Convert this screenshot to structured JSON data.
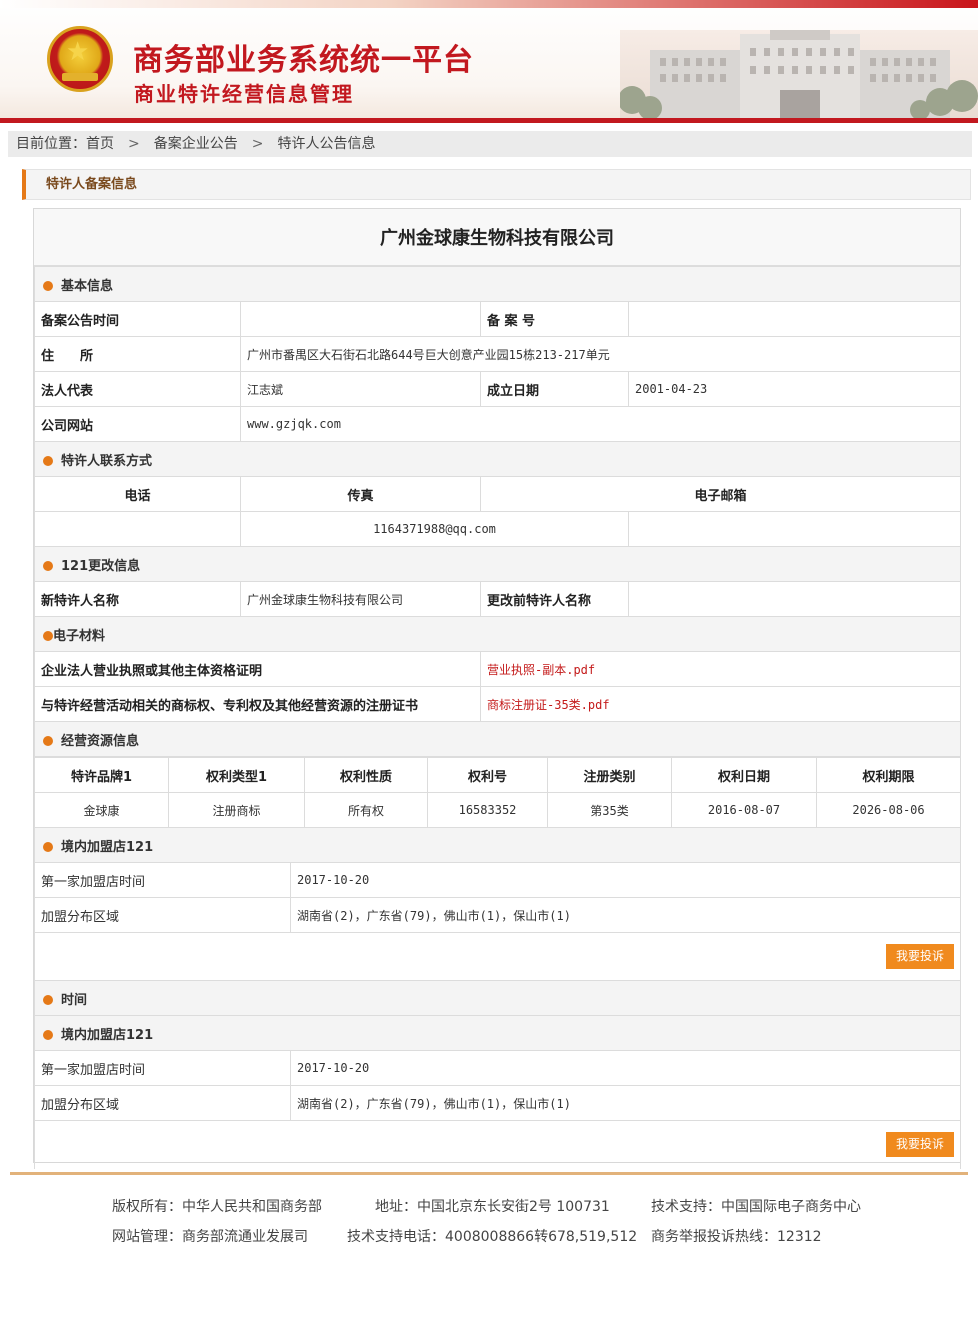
{
  "header": {
    "title": "商务部业务系统统一平台",
    "subtitle": "商业特许经营信息管理",
    "brand_color": "#c2181f"
  },
  "breadcrumb": {
    "prefix": "目前位置：",
    "items": [
      "首页",
      "备案企业公告",
      "特许人公告信息"
    ],
    "separator": ">"
  },
  "section_title": "特许人备案信息",
  "company_name": "广州金球康生物科技有限公司",
  "basic": {
    "heading": "基本信息",
    "record_time_label": "备案公告时间",
    "record_time_value": "",
    "record_no_label": "备 案 号",
    "record_no_value": "",
    "address_label": "住　　所",
    "address_value": "广州市番禺区大石街石北路644号巨大创意产业园15栋213-217单元",
    "legal_rep_label": "法人代表",
    "legal_rep_value": "江志斌",
    "founded_label": "成立日期",
    "founded_value": "2001-04-23",
    "website_label": "公司网站",
    "website_value": "www.gzjqk.com"
  },
  "contact": {
    "heading": "特许人联系方式",
    "phone_label": "电话",
    "fax_label": "传真",
    "email_label": "电子邮箱",
    "phone_value": "",
    "email_value": "1164371988@qq.com",
    "extra_value": ""
  },
  "change": {
    "heading": "121更改信息",
    "new_name_label": "新特许人名称",
    "new_name_value": "广州金球康生物科技有限公司",
    "old_name_label": "更改前特许人名称",
    "old_name_value": ""
  },
  "materials": {
    "heading": "电子材料",
    "rows": [
      {
        "label": "企业法人营业执照或其他主体资格证明",
        "file": "营业执照-副本.pdf"
      },
      {
        "label": "与特许经营活动相关的商标权、专利权及其他经营资源的注册证书",
        "file": "商标注册证-35类.pdf"
      }
    ]
  },
  "resources": {
    "heading": "经营资源信息",
    "columns": [
      "特许品牌1",
      "权利类型1",
      "权利性质",
      "权利号",
      "注册类别",
      "权利日期",
      "权利期限"
    ],
    "rows": [
      [
        "金球康",
        "注册商标",
        "所有权",
        "16583352",
        "第35类",
        "2016-08-07",
        "2026-08-06"
      ]
    ]
  },
  "stores1": {
    "heading": "境内加盟店121",
    "first_label": "第一家加盟店时间",
    "first_value": "2017-10-20",
    "dist_label": "加盟分布区域",
    "dist_value": "湖南省(2)，广东省(79)，佛山市(1)，保山市(1)",
    "button": "我要投诉"
  },
  "time_heading": "时间",
  "stores2": {
    "heading": "境内加盟店121",
    "first_label": "第一家加盟店时间",
    "first_value": "2017-10-20",
    "dist_label": "加盟分布区域",
    "dist_value": "湖南省(2)，广东省(79)，佛山市(1)，保山市(1)",
    "button": "我要投诉"
  },
  "footer": {
    "copyright": "版权所有：中华人民共和国商务部",
    "address": "地址：中国北京东长安街2号 100731",
    "tech": "技术支持：中国国际电子商务中心",
    "admin": "网站管理：商务部流通业发展司",
    "tech_phone": "技术支持电话：4008008866转678,519,512",
    "hotline": "商务举报投诉热线：12312"
  },
  "colors": {
    "accent": "#e57917",
    "button": "#f08a1e",
    "link": "#c41a1a"
  }
}
